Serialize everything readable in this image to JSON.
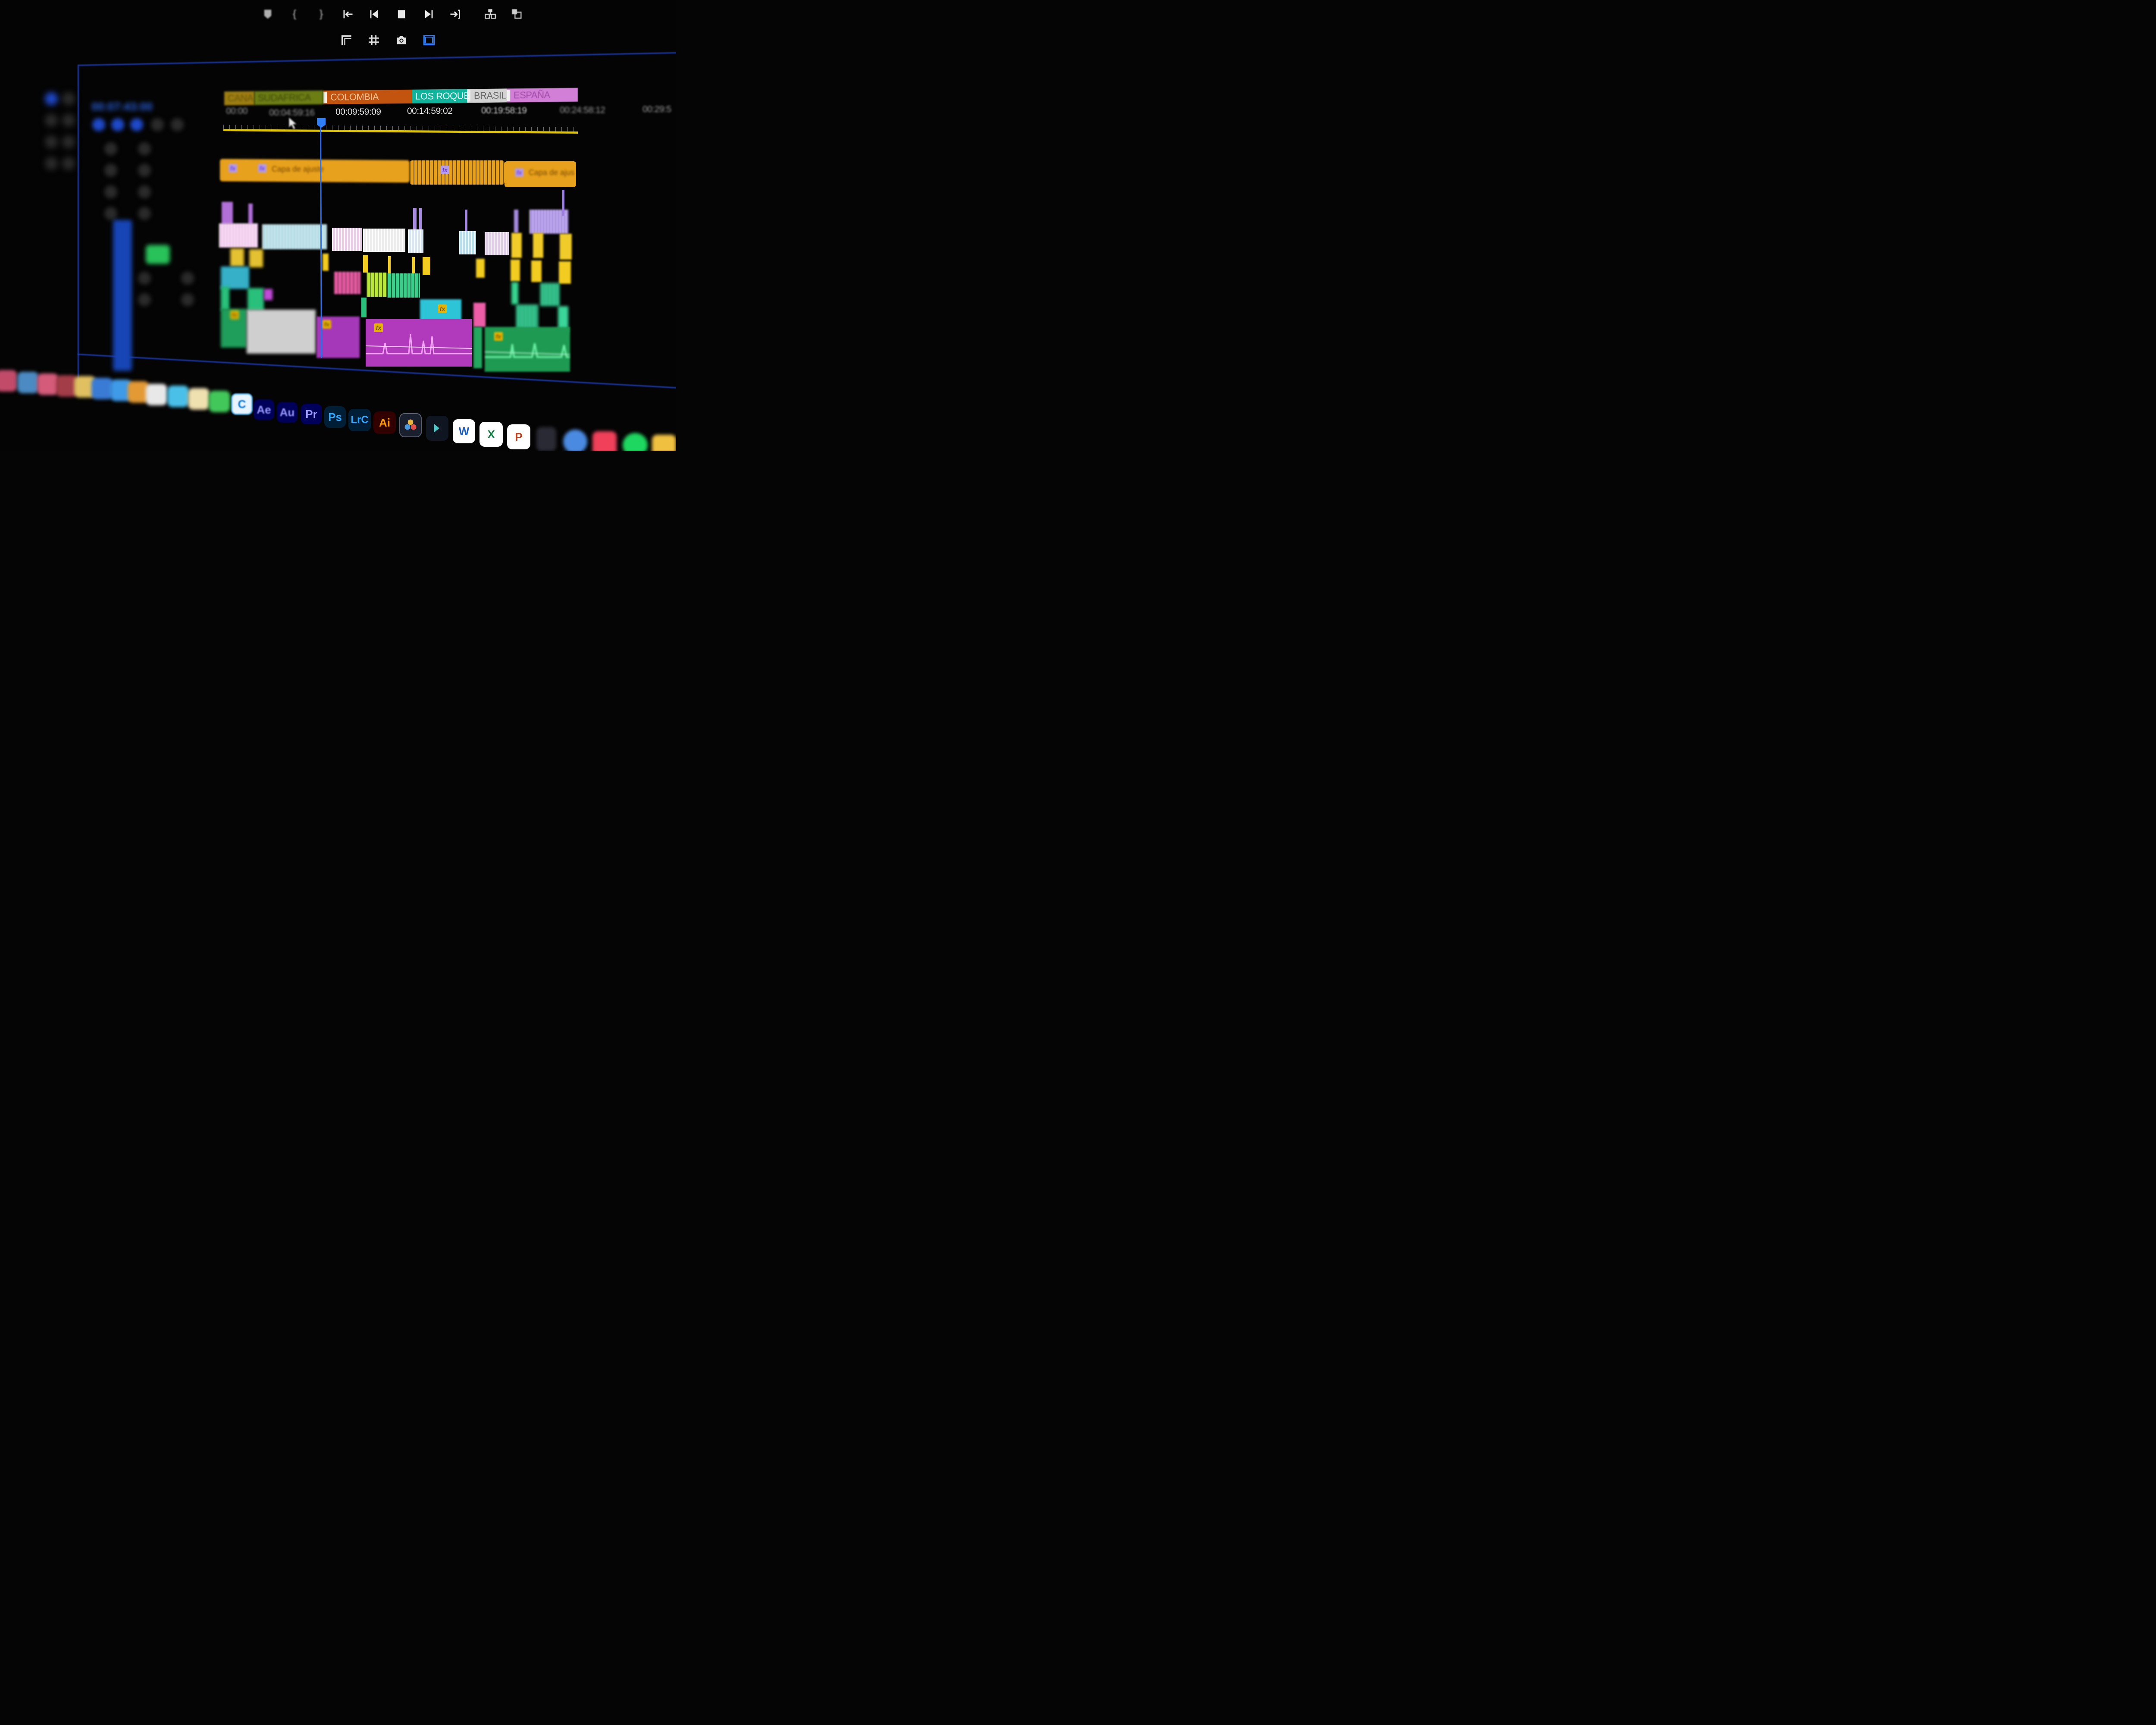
{
  "program_monitor": {
    "transport_controls": [
      {
        "name": "add-marker-icon",
        "glyph": "⛊"
      },
      {
        "name": "mark-in-icon",
        "glyph": "{"
      },
      {
        "name": "mark-out-icon",
        "glyph": "}"
      },
      {
        "name": "go-to-in-icon",
        "glyph": "⇤"
      },
      {
        "name": "step-back-icon",
        "glyph": "◀"
      },
      {
        "name": "stop-icon",
        "glyph": "■"
      },
      {
        "name": "step-forward-icon",
        "glyph": "▶"
      },
      {
        "name": "go-to-out-icon",
        "glyph": "⇥"
      },
      {
        "name": "lift-icon",
        "glyph": "⊞"
      },
      {
        "name": "extract-icon",
        "glyph": "⧉"
      }
    ],
    "secondary_controls": [
      {
        "name": "trim-icon",
        "glyph": "⌜"
      },
      {
        "name": "grid-icon",
        "glyph": "#"
      },
      {
        "name": "camera-icon",
        "glyph": "📷"
      },
      {
        "name": "safe-margins-icon",
        "glyph": "▭"
      }
    ]
  },
  "timeline": {
    "markers": [
      "CANA",
      "SUDAFRICA",
      "COLOMBIA",
      "LOS ROQUES",
      "BRASIL",
      "ESPAÑA"
    ],
    "timecodes": [
      "00:00",
      "00:04:59:16",
      "00:09:59:09",
      "00:14:59:02",
      "00:19:58:19",
      "00:24:58:12",
      "00:29:5"
    ],
    "adjustment_clip_labels": [
      "Capa de ajuste",
      "Capa de ajus"
    ],
    "fx_label": "fx"
  },
  "dock": {
    "apps": [
      {
        "label": "Ae",
        "color": "#9a9aff",
        "bg": "#00005b"
      },
      {
        "label": "Au",
        "color": "#9999ff",
        "bg": "#00005b"
      },
      {
        "label": "Pr",
        "color": "#9999ff",
        "bg": "#00005b"
      },
      {
        "label": "Ps",
        "color": "#31a8ff",
        "bg": "#001e36"
      },
      {
        "label": "LrC",
        "color": "#31a8ff",
        "bg": "#001e36"
      },
      {
        "label": "Ai",
        "color": "#ff9a00",
        "bg": "#330000"
      }
    ],
    "office": [
      {
        "label": "W",
        "color": "#ffffff",
        "bg": "#185abd"
      },
      {
        "label": "X",
        "color": "#ffffff",
        "bg": "#107c41"
      },
      {
        "label": "P",
        "color": "#ffffff",
        "bg": "#c43e1c"
      }
    ]
  }
}
